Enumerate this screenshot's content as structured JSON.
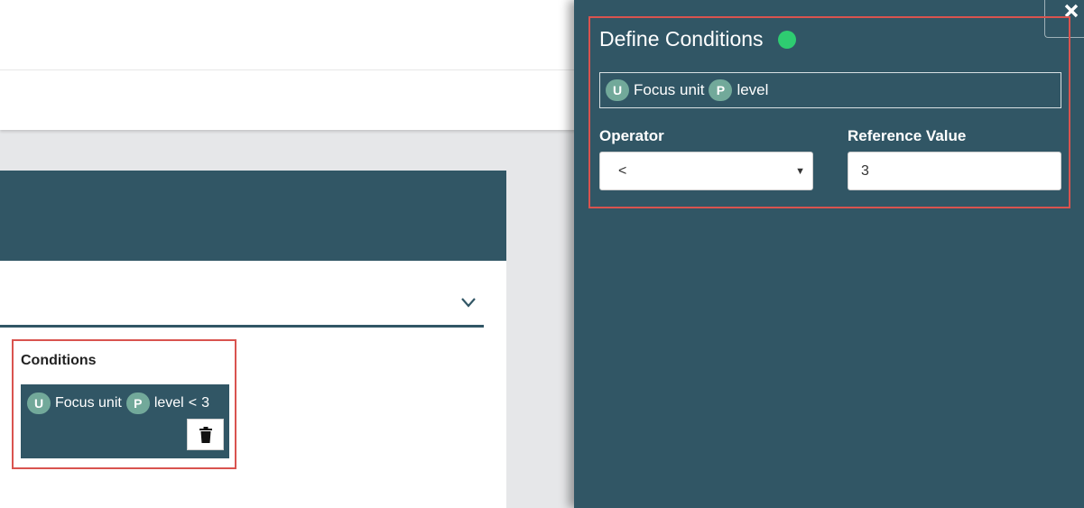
{
  "conditions_section": {
    "title": "Conditions",
    "item": {
      "unit_badge": "U",
      "unit_label": "Focus unit",
      "property_badge": "P",
      "property_label": "level",
      "operator": "<",
      "value": "3"
    }
  },
  "define_panel": {
    "title": "Define Conditions",
    "status_color": "#2ecc71",
    "expression": {
      "unit_badge": "U",
      "unit_label": "Focus unit",
      "property_badge": "P",
      "property_label": "level"
    },
    "operator_label": "Operator",
    "operator_value": "<",
    "reference_label": "Reference Value",
    "reference_value": "3"
  },
  "icons": {
    "close": "close-icon",
    "trash": "trash-icon",
    "chevron": "chevron-down-icon",
    "dropdown": "dropdown-arrow-icon",
    "status": "status-dot-icon"
  },
  "colors": {
    "panel": "#315665",
    "badge": "#72a99a",
    "highlight": "#d9534f",
    "status": "#2ecc71"
  }
}
